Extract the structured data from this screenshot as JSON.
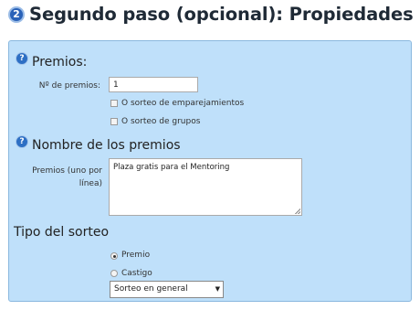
{
  "header": {
    "step_number": "2",
    "title": "Segundo paso (opcional): Propiedades de los premi"
  },
  "prizes_section": {
    "help_icon": "question-icon",
    "title": "Premios:",
    "count_label": "Nº de premios:",
    "count_value": "1",
    "option_pairing": "O sorteo de emparejamientos",
    "option_groups": "O sorteo de grupos"
  },
  "names_section": {
    "help_icon": "question-icon",
    "title": "Nombre de los premios",
    "field_label_line1": "Premios (uno por",
    "field_label_line2": "línea)",
    "field_value": "Plaza gratis para el Mentoring"
  },
  "draw_type_section": {
    "title": "Tipo del sorteo",
    "option_prize": "Premio",
    "option_punishment": "Castigo",
    "selected_option": "Premio",
    "select_value": "Sorteo en general"
  },
  "colors": {
    "panel_background": "#bfe0fa",
    "panel_border": "#8ab8df",
    "step_badge": "#2a62b8"
  }
}
